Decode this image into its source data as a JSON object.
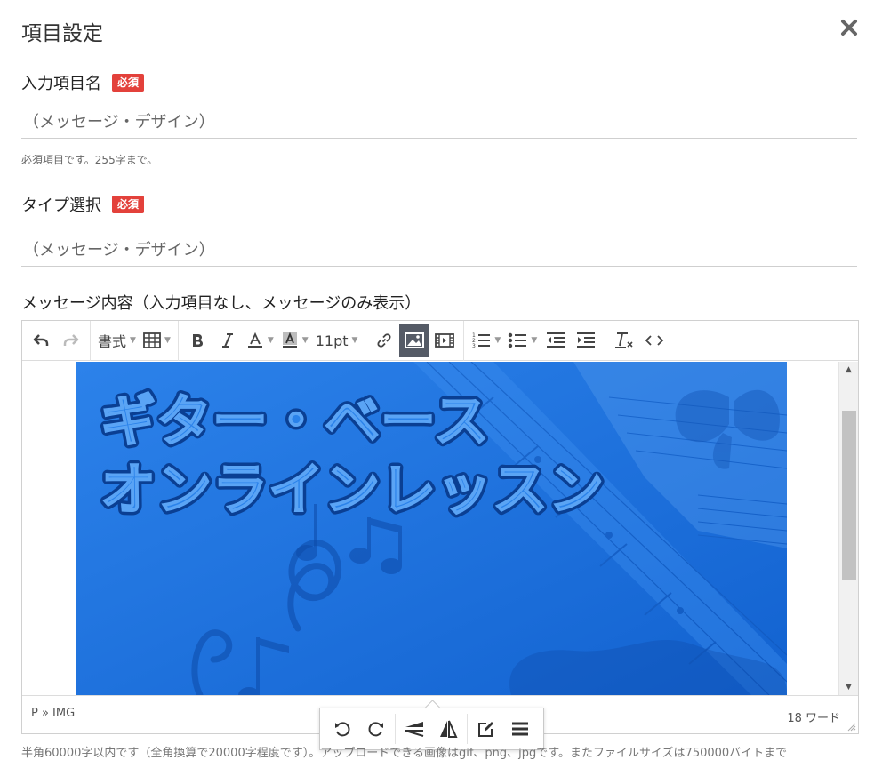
{
  "modal": {
    "title": "項目設定",
    "close_icon": "close-icon"
  },
  "field_name": {
    "label": "入力項目名",
    "required_badge": "必須",
    "value": "（メッセージ・デザイン）",
    "help": "必須項目です。255字まで。"
  },
  "field_type": {
    "label": "タイプ選択",
    "required_badge": "必須",
    "value": "（メッセージ・デザイン）"
  },
  "message": {
    "label": "メッセージ内容（入力項目なし、メッセージのみ表示）"
  },
  "toolbar": {
    "format_label": "書式",
    "font_size_label": "11pt",
    "icons": [
      "undo-icon",
      "redo-icon",
      "table-icon",
      "bold-icon",
      "italic-icon",
      "text-color-icon",
      "background-color-icon",
      "link-icon",
      "image-icon",
      "media-icon",
      "numbered-list-icon",
      "bullet-list-icon",
      "outdent-icon",
      "indent-icon",
      "clear-formatting-icon",
      "source-code-icon"
    ]
  },
  "banner": {
    "line1": "ギター・ベース",
    "line2": "オンラインレッスン",
    "color": "#1b6fe0"
  },
  "statusbar": {
    "path": "P » IMG",
    "wordcount": "18 ワード"
  },
  "image_toolbar": {
    "icons": [
      "rotate-left-icon",
      "rotate-right-icon",
      "flip-vertical-icon",
      "flip-horizontal-icon",
      "edit-image-icon",
      "image-options-icon"
    ]
  },
  "bottom_help": "半角60000字以内です（全角換算で20000字程度です）。アップロードできる画像はgif、png、jpgです。またファイルサイズは750000バイトまで"
}
